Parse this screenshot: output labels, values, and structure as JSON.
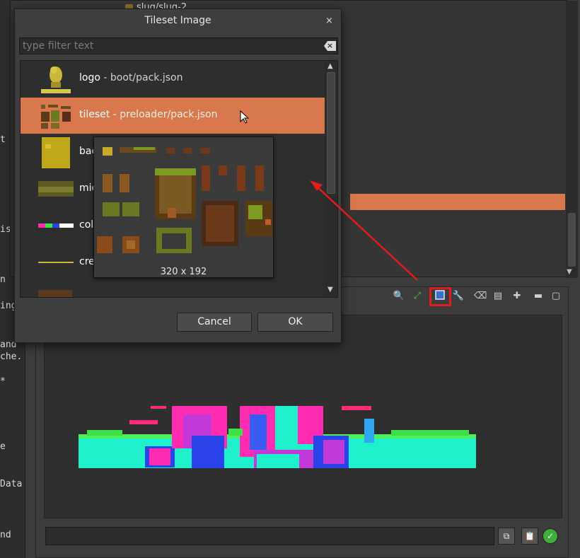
{
  "background": {
    "tree_title": "slug/slug-2",
    "code_lines": [
      "t",
      "is",
      "n",
      "ing",
      "and",
      "che.",
      "*",
      "e",
      "Data",
      "nd"
    ]
  },
  "dialog": {
    "title": "Tileset Image",
    "close_icon": "close-icon",
    "filter": {
      "placeholder": "type filter text",
      "value": ""
    },
    "items": [
      {
        "key": "logo",
        "path": "boot/pack.json",
        "selected": false
      },
      {
        "key": "tileset",
        "path": "preloader/pack.json",
        "selected": true
      },
      {
        "key": "bac",
        "path": "",
        "selected": false
      },
      {
        "key": "mic",
        "path": "",
        "selected": false
      },
      {
        "key": "col",
        "path": "",
        "selected": false
      },
      {
        "key": "cre",
        "path": "",
        "selected": false
      }
    ],
    "cancel_label": "Cancel",
    "ok_label": "OK"
  },
  "preview": {
    "size_text": "320 x 192"
  },
  "colors": {
    "selection": "#d8784c",
    "highlight": "#e21b1b"
  }
}
